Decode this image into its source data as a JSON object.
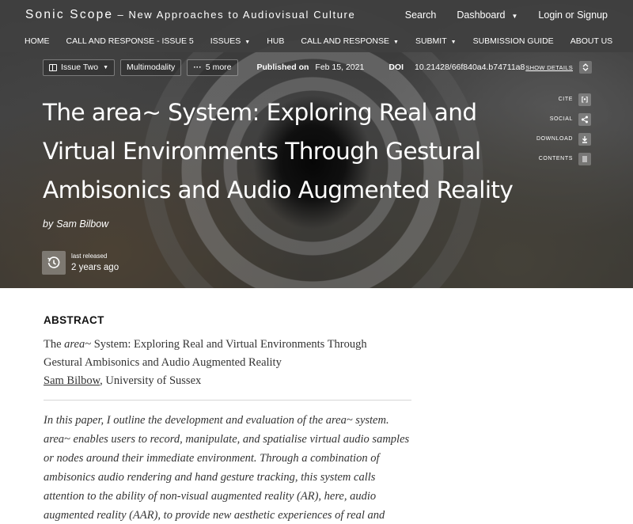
{
  "header": {
    "site_name": "Sonic Scope",
    "site_tagline": " – New Approaches to Audiovisual Culture",
    "search": "Search",
    "dashboard": "Dashboard",
    "login": "Login or Signup"
  },
  "nav": {
    "items": [
      {
        "label": "HOME",
        "dropdown": false
      },
      {
        "label": "CALL AND RESPONSE - ISSUE 5",
        "dropdown": false
      },
      {
        "label": "ISSUES",
        "dropdown": true
      },
      {
        "label": "HUB",
        "dropdown": false
      },
      {
        "label": "CALL AND RESPONSE",
        "dropdown": true
      },
      {
        "label": "SUBMIT",
        "dropdown": true
      },
      {
        "label": "SUBMISSION GUIDE",
        "dropdown": false
      },
      {
        "label": "ABOUT US",
        "dropdown": false
      }
    ]
  },
  "meta": {
    "issue_chip": "Issue Two",
    "tag_chip": "Multimodality",
    "more_chip": "5 more",
    "published_label": "Published on",
    "published_date": "Feb 15, 2021",
    "doi_label": "DOI",
    "doi_value": "10.21428/66f840a4.b74711a8",
    "show_details": "SHOW DETAILS"
  },
  "article": {
    "title": "The area~ System: Exploring Real and Virtual Environments Through Gestural Ambisonics and Audio Augmented Reality",
    "by": "by",
    "author": "Sam Bilbow",
    "release_label": "last released",
    "release_value": "2 years ago"
  },
  "tools": {
    "cite": "CITE",
    "social": "SOCIAL",
    "download": "DOWNLOAD",
    "contents": "CONTENTS"
  },
  "abstract": {
    "heading": "ABSTRACT",
    "ref_title_start": "The ",
    "ref_title_italic": "area~",
    "ref_title_line1_rest": " System: Exploring Real and Virtual Environments Through",
    "ref_title_line2": "Gestural Ambisonics and Audio Augmented Reality",
    "ref_author": "Sam Bilbow",
    "ref_affiliation": ", University of Sussex",
    "text": "In this paper, I outline the development and evaluation of the area~ system. area~ enables users to record, manipulate, and spatialise virtual audio samples or nodes around their immediate environment. Through a combination of ambisonics audio rendering and hand gesture tracking, this system calls attention to the ability of non-visual augmented reality (AR), here, audio augmented reality (AAR), to provide new aesthetic experiences of real and virtual environments. The system is"
  }
}
